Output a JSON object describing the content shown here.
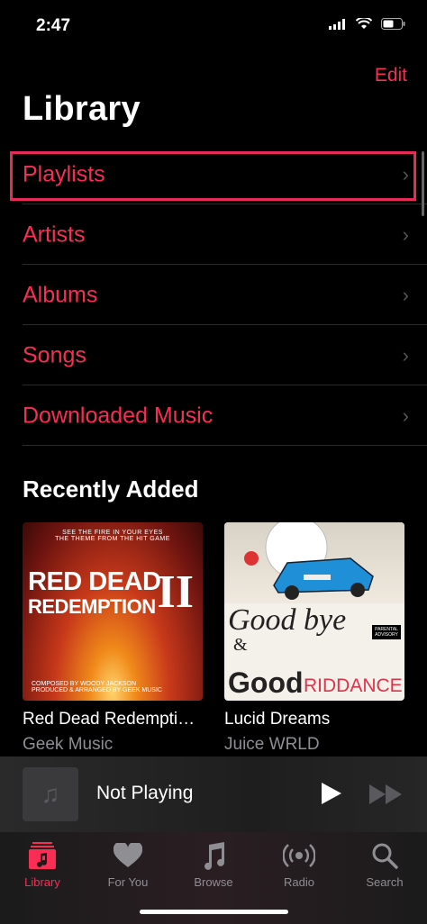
{
  "status": {
    "time": "2:47"
  },
  "header": {
    "edit_label": "Edit",
    "title": "Library"
  },
  "menu": [
    {
      "label": "Playlists"
    },
    {
      "label": "Artists"
    },
    {
      "label": "Albums"
    },
    {
      "label": "Songs"
    },
    {
      "label": "Downloaded Music"
    }
  ],
  "recently_added": {
    "heading": "Recently Added",
    "albums": [
      {
        "title": "Red Dead Redemptio…",
        "artist": "Geek Music",
        "cover_top": "SEE THE FIRE IN YOUR EYES",
        "cover_sub": "THE THEME FROM THE HIT GAME",
        "cover_line1": "RED DEAD",
        "cover_line2": "REDEMPTION",
        "cover_roman": "II",
        "cover_credit1": "COMPOSED BY WOODY JACKSON",
        "cover_credit2": "PRODUCED & ARRANGED BY GEEK MUSIC"
      },
      {
        "title": "Lucid Dreams",
        "artist": "Juice WRLD",
        "cover_line1": "Good bye",
        "cover_amp": "&",
        "cover_line2": "Good",
        "cover_line3": "RIDDANCE",
        "cover_advisory": "PARENTAL ADVISORY"
      }
    ]
  },
  "miniplayer": {
    "label": "Not Playing"
  },
  "tabs": [
    {
      "label": "Library",
      "icon": "library-icon"
    },
    {
      "label": "For You",
      "icon": "heart-icon"
    },
    {
      "label": "Browse",
      "icon": "music-note-icon"
    },
    {
      "label": "Radio",
      "icon": "radio-icon"
    },
    {
      "label": "Search",
      "icon": "search-icon"
    }
  ],
  "colors": {
    "accent": "#fa2d55",
    "highlight_box": "#e9285c"
  }
}
